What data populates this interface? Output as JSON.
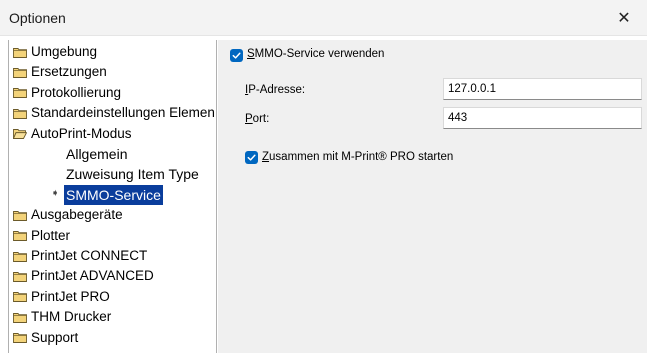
{
  "window": {
    "title": "Optionen",
    "close_glyph": "✕"
  },
  "tree": {
    "items": [
      {
        "label": "Umgebung",
        "type": "folder"
      },
      {
        "label": "Ersetzungen",
        "type": "folder"
      },
      {
        "label": "Protokollierung",
        "type": "folder"
      },
      {
        "label": "Standardeinstellungen Elemen",
        "type": "folder"
      },
      {
        "label": "AutoPrint-Modus",
        "type": "folder-open"
      },
      {
        "label": "Allgemein",
        "type": "child"
      },
      {
        "label": "Zuweisung Item Type",
        "type": "child"
      },
      {
        "label": "SMMO-Service",
        "type": "child-selected"
      },
      {
        "label": "Ausgabegeräte",
        "type": "folder"
      },
      {
        "label": "Plotter",
        "type": "folder"
      },
      {
        "label": "PrintJet CONNECT",
        "type": "folder"
      },
      {
        "label": "PrintJet ADVANCED",
        "type": "folder"
      },
      {
        "label": "PrintJet PRO",
        "type": "folder"
      },
      {
        "label": "THM Drucker",
        "type": "folder"
      },
      {
        "label": "Support",
        "type": "folder"
      }
    ]
  },
  "panel": {
    "use_service": {
      "first": "S",
      "rest": "MMO-Service verwenden",
      "checked": true
    },
    "ip": {
      "label_first": "I",
      "label_rest": "P-Adresse:",
      "value": "127.0.0.1"
    },
    "port": {
      "label_first": "P",
      "label_rest": "ort:",
      "value": "443"
    },
    "start_with": {
      "first": "Z",
      "rest": "usammen mit M-Print® PRO starten",
      "checked": true
    }
  },
  "colors": {
    "selection": "#0a3d9c",
    "checkbox": "#0067c0",
    "folder": "#f3d37a"
  }
}
